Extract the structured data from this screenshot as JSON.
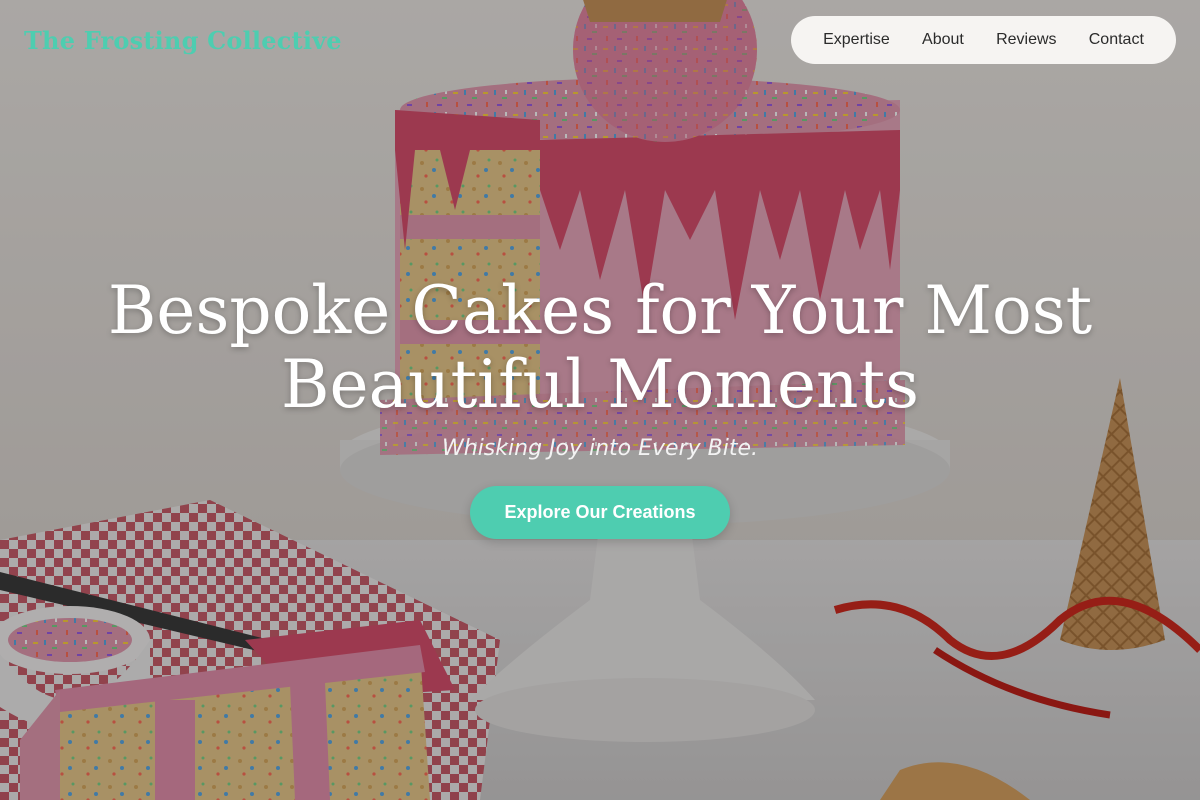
{
  "brand": {
    "name": "The Frosting Collective",
    "accent_color": "#4ecdb0"
  },
  "nav": {
    "items": [
      {
        "label": "Expertise"
      },
      {
        "label": "About"
      },
      {
        "label": "Reviews"
      },
      {
        "label": "Contact"
      }
    ]
  },
  "hero": {
    "headline_line1": "Bespoke Cakes for Your Most",
    "headline_line2": "Beautiful Moments",
    "tagline": "Whisking Joy into Every Bite.",
    "cta_label": "Explore Our Creations",
    "cta_color": "#4ecdb0"
  },
  "background": {
    "image_subject": "pink drip layer cake on white cake stand with sprinkles, cake slice, red checkered cloth, waffle cones and red ribbon",
    "colors": {
      "frosting_pink": "#e6a0b6",
      "drip_red": "#d8506e",
      "stand_white": "#e9e7e6",
      "wall": "#e7e3df",
      "counter": "#dedcdb",
      "cone": "#c79658"
    }
  }
}
